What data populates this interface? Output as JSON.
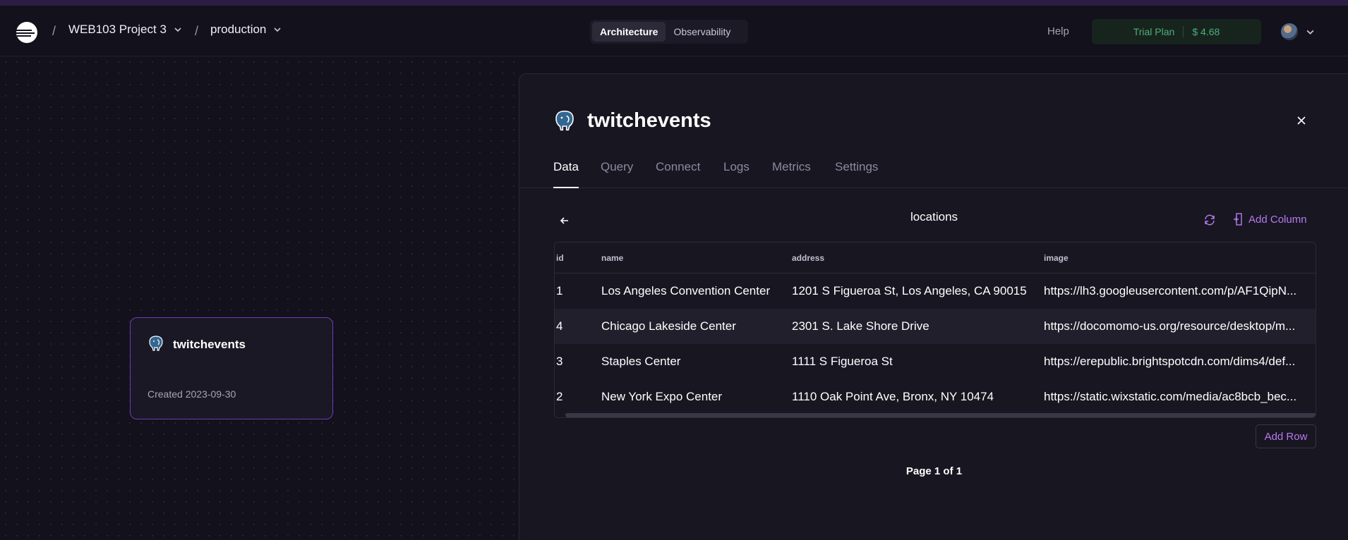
{
  "navbar": {
    "project_name": "WEB103 Project 3",
    "environment": "production",
    "separator": "/",
    "view_toggle": [
      "Architecture",
      "Observability"
    ],
    "active_view": "Architecture",
    "help_label": "Help",
    "plan_label": "Trial Plan",
    "plan_balance": "$ 4.68"
  },
  "canvas": {
    "node": {
      "title": "twitchevents",
      "created": "Created 2023-09-30",
      "icon": "postgres-elephant-icon"
    }
  },
  "panel": {
    "title": "twitchevents",
    "tabs": [
      "Data",
      "Query",
      "Connect",
      "Logs",
      "Metrics",
      "Settings"
    ],
    "active_tab": "Data",
    "table_name": "locations",
    "add_column_label": "Add Column",
    "add_row_label": "Add Row",
    "pagination": "Page 1 of 1",
    "columns": [
      "id",
      "name",
      "address",
      "image"
    ],
    "rows": [
      [
        "1",
        "Los Angeles Convention Center",
        "1201 S Figueroa St, Los Angeles, CA 90015",
        "https://lh3.googleusercontent.com/p/AF1QipN..."
      ],
      [
        "4",
        "Chicago Lakeside Center",
        "2301 S. Lake Shore Drive",
        "https://docomomo-us.org/resource/desktop/m..."
      ],
      [
        "3",
        "Staples Center",
        "1111 S Figueroa St",
        "https://erepublic.brightspotcdn.com/dims4/def..."
      ],
      [
        "2",
        "New York Expo Center",
        "1110 Oak Point Ave, Bronx, NY 10474",
        "https://static.wixstatic.com/media/ac8bcb_bec..."
      ]
    ]
  },
  "colors": {
    "background": "#13111c",
    "panel": "#181621",
    "accent_purple": "#b57bf0",
    "node_border": "#6c3bb8",
    "plan_green": "#4fae79"
  }
}
